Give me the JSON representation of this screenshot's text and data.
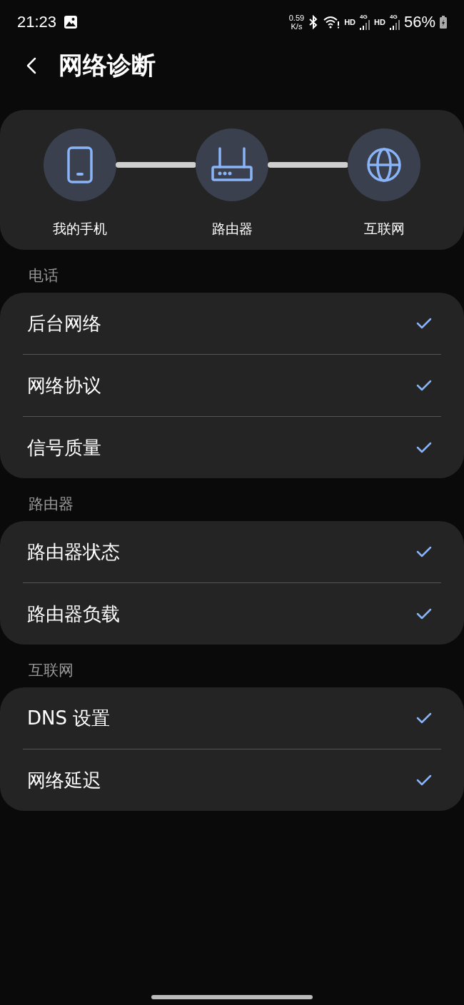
{
  "status_bar": {
    "time": "21:23",
    "speed_value": "0.59",
    "speed_unit": "K/s",
    "networks": [
      {
        "label": "HD",
        "tech": "4G"
      },
      {
        "label": "HD",
        "tech": "4G"
      }
    ],
    "battery": "56%"
  },
  "header": {
    "title": "网络诊断"
  },
  "path": [
    {
      "kind": "phone",
      "label": "我的手机"
    },
    {
      "kind": "router",
      "label": "路由器"
    },
    {
      "kind": "globe",
      "label": "互联网"
    }
  ],
  "sections": [
    {
      "title": "电话",
      "items": [
        {
          "label": "后台网络",
          "checked": true
        },
        {
          "label": "网络协议",
          "checked": true
        },
        {
          "label": "信号质量",
          "checked": true
        }
      ]
    },
    {
      "title": "路由器",
      "items": [
        {
          "label": "路由器状态",
          "checked": true
        },
        {
          "label": "路由器负载",
          "checked": true
        }
      ]
    },
    {
      "title": "互联网",
      "items": [
        {
          "label": "DNS 设置",
          "checked": true
        },
        {
          "label": "网络延迟",
          "checked": true
        }
      ]
    }
  ]
}
